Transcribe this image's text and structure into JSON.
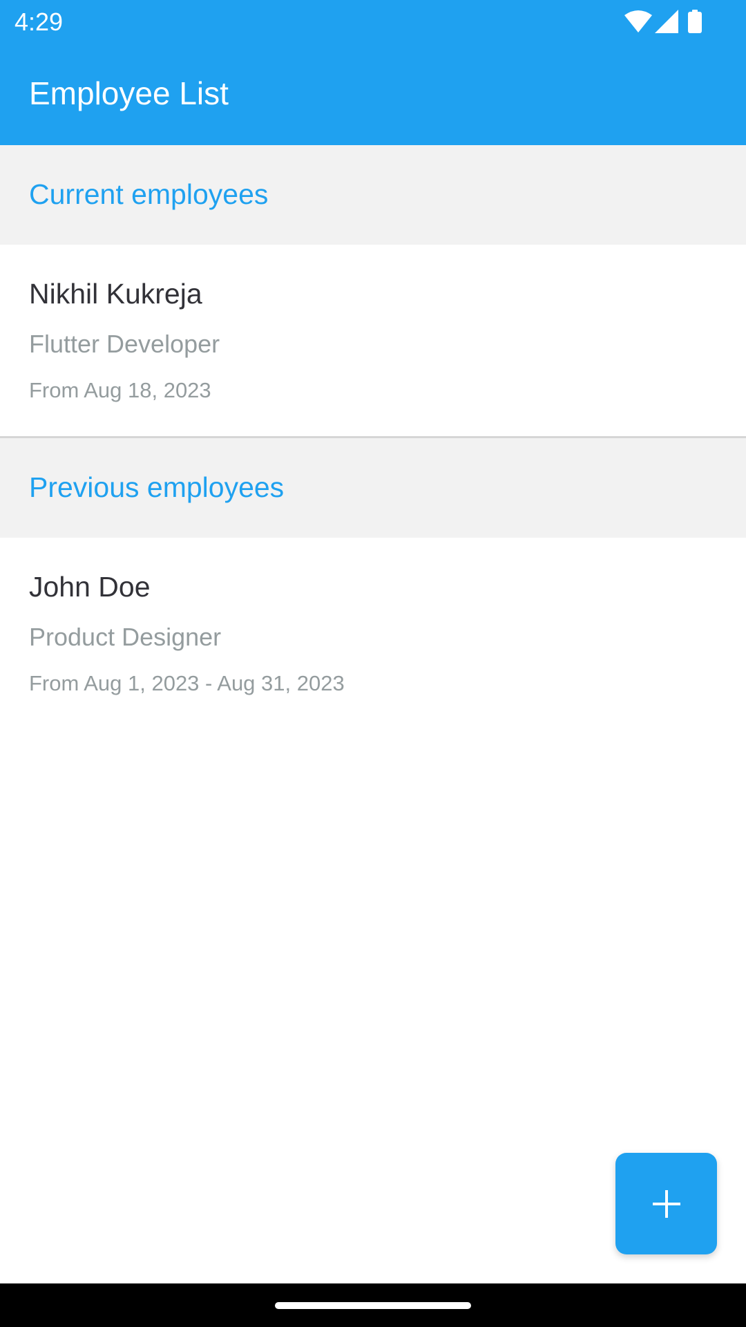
{
  "status_bar": {
    "time": "4:29",
    "icons": [
      "wifi-icon",
      "signal-icon",
      "battery-icon"
    ]
  },
  "app_bar": {
    "title": "Employee List"
  },
  "sections": {
    "current": {
      "title": "Current employees",
      "employees": [
        {
          "name": "Nikhil Kukreja",
          "role": "Flutter Developer",
          "dates": "From Aug 18, 2023"
        }
      ]
    },
    "previous": {
      "title": "Previous employees",
      "employees": [
        {
          "name": "John Doe",
          "role": "Product Designer",
          "dates": "From Aug 1, 2023 - Aug 31, 2023"
        }
      ]
    }
  },
  "fab": {
    "icon": "plus-icon"
  },
  "colors": {
    "primary": "#1fa1f0",
    "section_background": "#f2f2f2",
    "name_text": "#323238",
    "secondary_text": "#949c9e",
    "navigation_bar": "#000000"
  }
}
